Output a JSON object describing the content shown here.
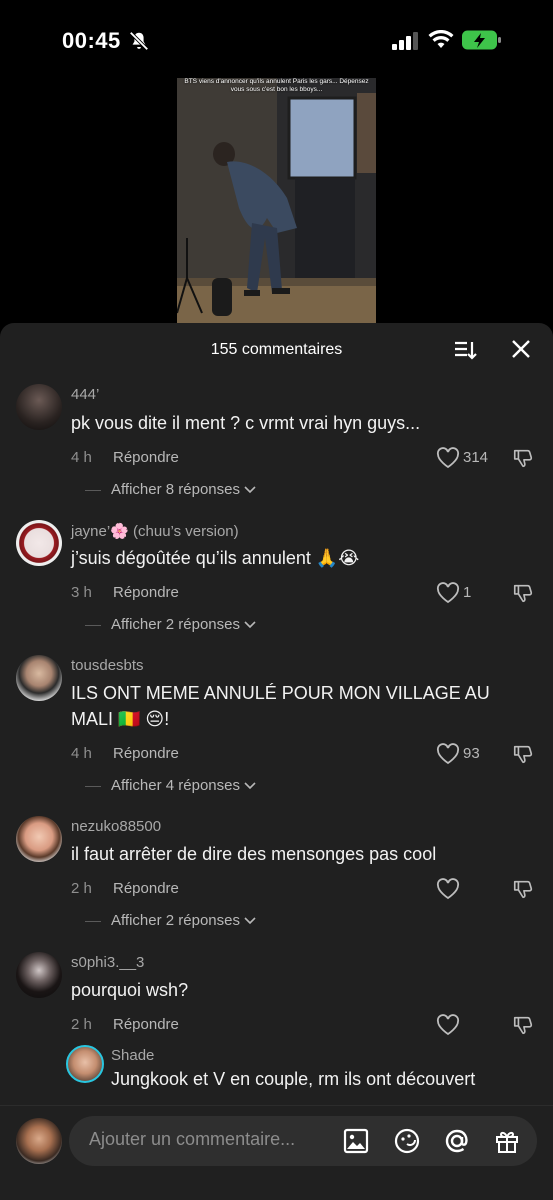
{
  "status": {
    "time": "00:45"
  },
  "video": {
    "caption": "BTS viens d'annoncer qu'ils annulent Paris les gars... Dépensez vous sous c'est bon les bboys..."
  },
  "sheet": {
    "title": "155 commentaires"
  },
  "labels": {
    "reply": "Répondre"
  },
  "comments": [
    {
      "username": "444’",
      "text": "pk vous dite il ment ? c vrmt vrai hyn guys...",
      "time": "4 h",
      "likes": "314",
      "replies": "Afficher 8 réponses"
    },
    {
      "username": "jayne’🌸 (chuu’s version)",
      "text": "j’suis dégoûtée qu’ils annulent 🙏😭",
      "time": "3 h",
      "likes": "1",
      "replies": "Afficher 2 réponses"
    },
    {
      "username": "tousdesbts",
      "text": "ILS ONT MEME ANNULÉ POUR MON VILLAGE AU MALI 🇲🇱 😔!",
      "time": "4 h",
      "likes": "93",
      "replies": "Afficher 4 réponses"
    },
    {
      "username": "nezuko88500",
      "text": "il faut arrêter de dire des mensonges pas cool",
      "time": "2 h",
      "likes": "",
      "replies": "Afficher 2 réponses"
    },
    {
      "username": "s0phi3.__3",
      "text": "pourquoi wsh?",
      "time": "2 h",
      "likes": "",
      "replies": ""
    }
  ],
  "nested_reply": {
    "username": "Shade",
    "text": "Jungkook et V en couple, rm ils ont découvert"
  },
  "composer": {
    "placeholder": "Ajouter un commentaire..."
  }
}
